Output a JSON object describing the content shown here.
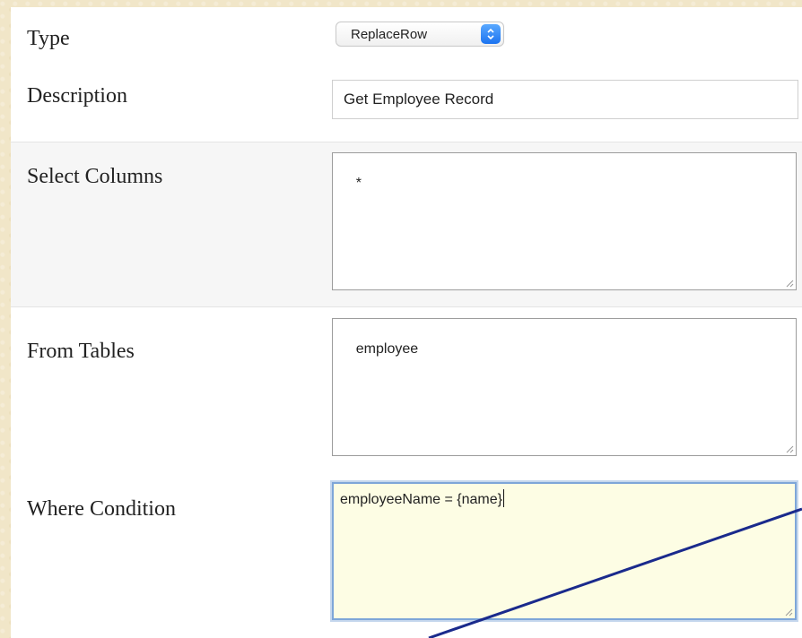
{
  "form": {
    "type": {
      "label": "Type",
      "value": "ReplaceRow"
    },
    "description": {
      "label": "Description",
      "value": "Get Employee Record"
    },
    "select_columns": {
      "label": "Select Columns",
      "value": "*"
    },
    "from_tables": {
      "label": "From Tables",
      "value": "employee"
    },
    "where_condition": {
      "label": "Where Condition",
      "value": "employeeName = {name}"
    }
  },
  "colors": {
    "background": "#f1e6c8",
    "focused_field": "#fdfde4",
    "focus_ring": "#7ea6d8",
    "select_accent": "#1c73f0",
    "annotation_line": "#1a2a8c"
  },
  "icons": {
    "select_arrows": "updown-chevron-icon",
    "resize_grip": "resize-grip-icon"
  }
}
